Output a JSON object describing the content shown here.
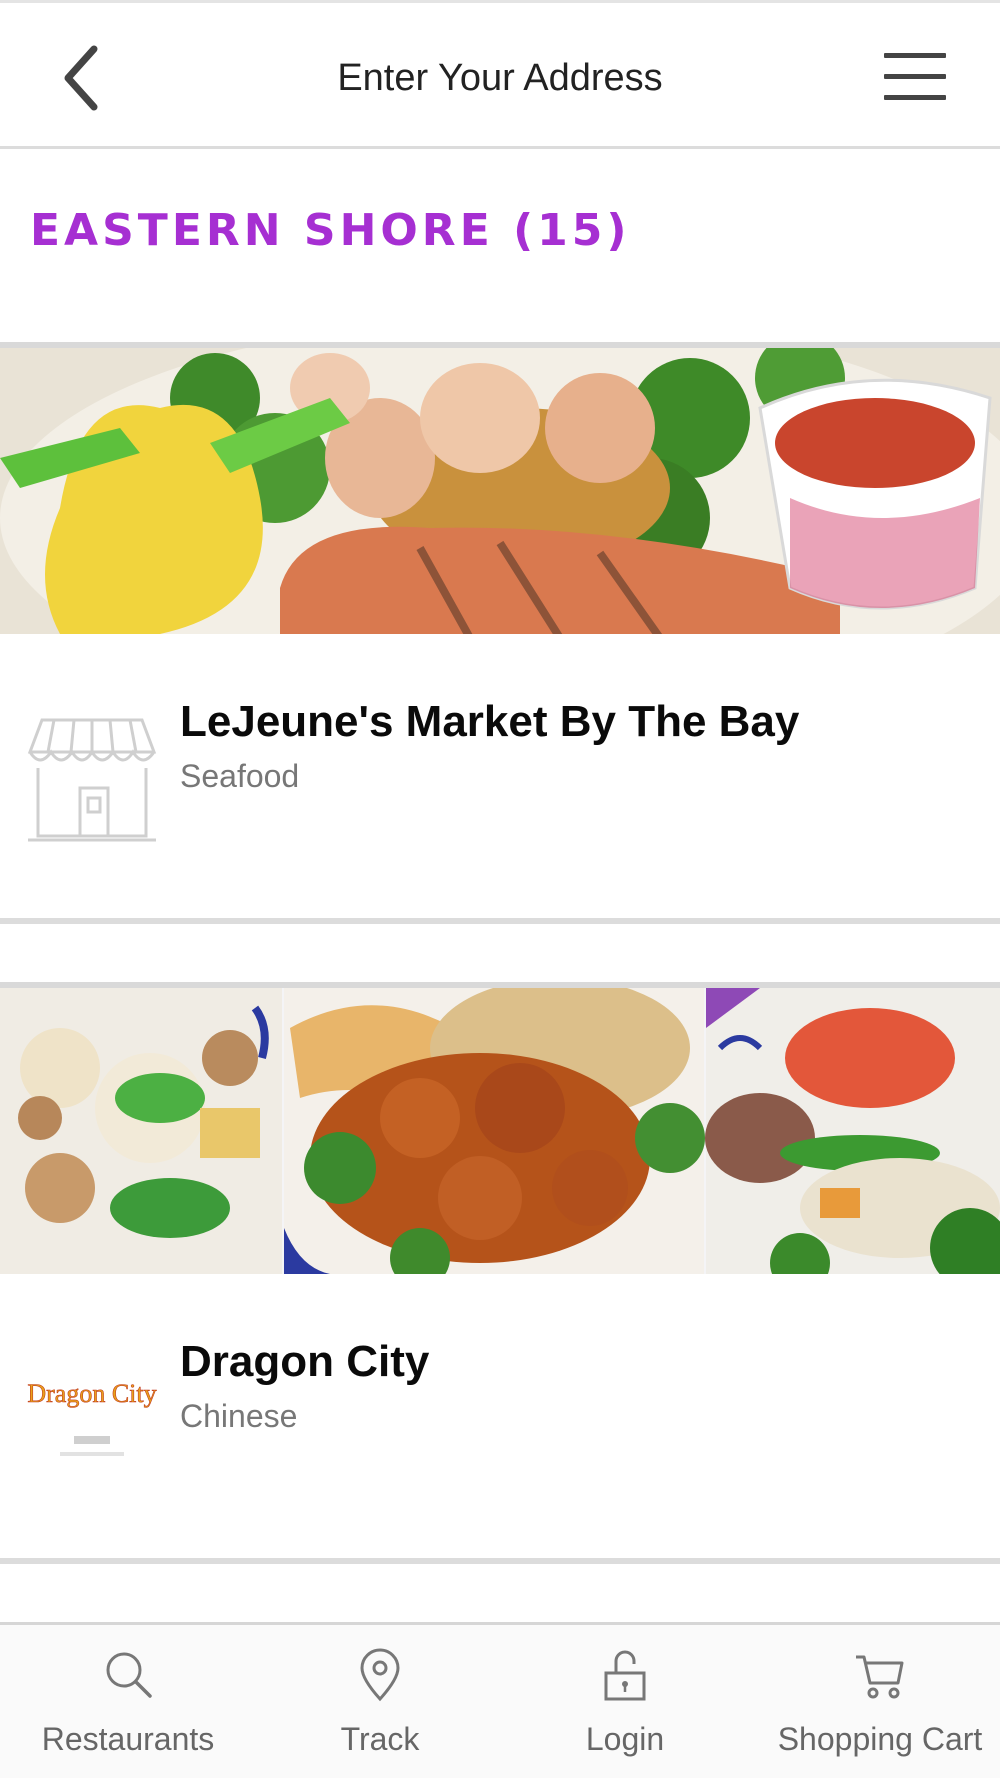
{
  "header": {
    "title": "Enter Your Address",
    "back_icon": "chevron-left-icon",
    "menu_icon": "hamburger-menu-icon"
  },
  "section": {
    "title": "EASTERN SHORE (15)",
    "color": "#a62fd2"
  },
  "restaurants": [
    {
      "name": "LeJeune's Market By The Bay",
      "category": "Seafood",
      "logo_icon": "storefront-icon"
    },
    {
      "name": "Dragon City",
      "category": "Chinese",
      "logo_text": "Dragon City"
    }
  ],
  "bottom_nav": [
    {
      "label": "Restaurants",
      "icon": "search-icon"
    },
    {
      "label": "Track",
      "icon": "location-pin-icon"
    },
    {
      "label": "Login",
      "icon": "unlock-icon"
    },
    {
      "label": "Shopping Cart",
      "icon": "cart-icon"
    }
  ]
}
